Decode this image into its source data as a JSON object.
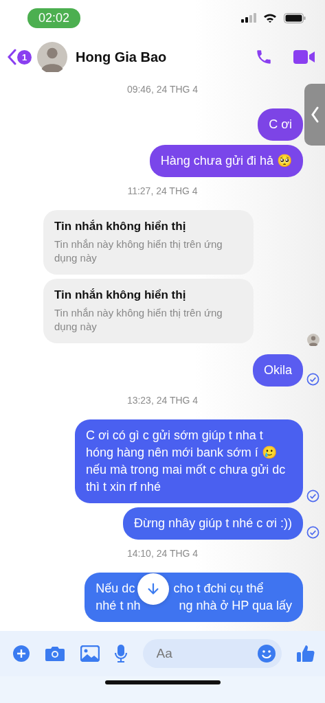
{
  "status_bar": {
    "time": "02:02"
  },
  "header": {
    "back_badge": "1",
    "name": "Hong Gia Bao"
  },
  "messages": [
    {
      "kind": "time",
      "text": "09:46, 24 THG 4"
    },
    {
      "kind": "out",
      "lines": [
        [
          "C ơi"
        ]
      ],
      "color": "#7d44e6",
      "delivered": false
    },
    {
      "kind": "out",
      "lines": [
        [
          "Hàng chưa gửi đi hả 🥺"
        ]
      ],
      "color": "#7a46ea",
      "delivered": false
    },
    {
      "kind": "time",
      "text": "11:27, 24 THG 4"
    },
    {
      "kind": "hidden",
      "title": "Tin nhắn không hiển thị",
      "body": "Tin nhắn này không hiển thị trên ứng dụng này"
    },
    {
      "kind": "hidden",
      "title": "Tin nhắn không hiển thị",
      "body": "Tin nhắn này không hiển thị trên ứng dụng này"
    },
    {
      "kind": "seen"
    },
    {
      "kind": "out",
      "lines": [
        [
          "Okila"
        ]
      ],
      "color": "#5a5cf0",
      "delivered": true
    },
    {
      "kind": "time",
      "text": "13:23, 24 THG 4"
    },
    {
      "kind": "out",
      "lines": [
        [
          "C ơi có gì c gửi sớm giúp t nha t hóng hàng nên mới bank sớm í 🥲 nếu mà trong mai mốt c chưa gửi dc thì t xin rf nhé"
        ]
      ],
      "color": "#4a60f0",
      "delivered": true
    },
    {
      "kind": "out",
      "lines": [
        [
          "Đừng nhây giúp t nhé c ơi :))"
        ]
      ],
      "color": "#4766ef",
      "delivered": true
    },
    {
      "kind": "time",
      "text": "14:10, 24 THG 4"
    },
    {
      "kind": "out",
      "lines": [
        [
          "Nếu dc",
          "cho t đchi cụ thể"
        ],
        [
          "nhé t nh",
          "ng nhà ở HP qua lấy"
        ]
      ],
      "color": "#3f74f0",
      "delivered": false,
      "covered": true
    }
  ],
  "composer": {
    "placeholder": "Aa"
  }
}
